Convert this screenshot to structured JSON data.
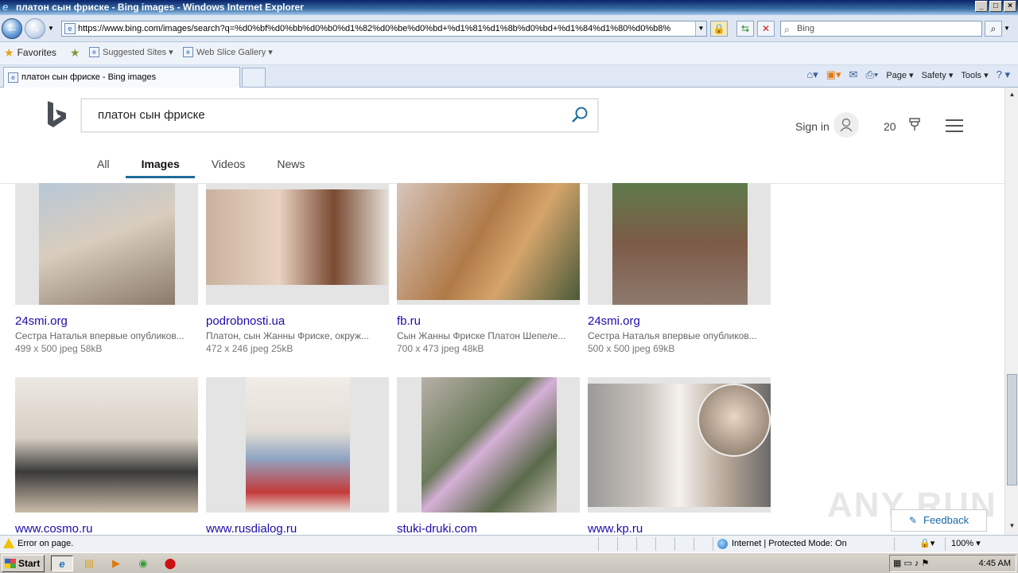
{
  "window": {
    "title": "платон сын фриске - Bing images - Windows Internet Explorer",
    "controls": [
      "_",
      "□",
      "×"
    ]
  },
  "nav": {
    "url": "https://www.bing.com/images/search?q=%d0%bf%d0%bb%d0%b0%d1%82%d0%be%d0%bd+%d1%81%d1%8b%d0%bd+%d1%84%d1%80%d0%b8%",
    "search_placeholder": "Bing"
  },
  "favorites": {
    "label": "Favorites",
    "items": [
      "Suggested Sites ▾",
      "Web Slice Gallery ▾"
    ]
  },
  "tab": {
    "title": "платон сын фриске - Bing images"
  },
  "commands": {
    "page": "Page ▾",
    "safety": "Safety ▾",
    "tools": "Tools ▾",
    "help": "? ▾"
  },
  "bing": {
    "query": "платон сын фриске",
    "sign_in": "Sign in",
    "points": "20",
    "scopes": [
      "All",
      "Images",
      "Videos",
      "News"
    ],
    "active_scope": "Images",
    "feedback": "Feedback"
  },
  "results": [
    {
      "source": "24smi.org",
      "desc": "Сестра Наталья впервые опубликов...",
      "meta": "499 x 500 jpeg 58kB",
      "thumb_color": "#c9b9a6"
    },
    {
      "source": "podrobnosti.ua",
      "desc": "Платон, сын Жанны Фриске, окруж...",
      "meta": "472 x 246 jpeg 25kB",
      "thumb_color": "#d8b4a0"
    },
    {
      "source": "fb.ru",
      "desc": "Сын Жанны Фриске Платон Шепеле...",
      "meta": "700 x 473 jpeg 48kB",
      "thumb_color": "#b58a5c"
    },
    {
      "source": "24smi.org",
      "desc": "Сестра Наталья впервые опубликов...",
      "meta": "500 x 500 jpeg 69kB",
      "thumb_color": "#6d7a5a"
    },
    {
      "source": "www.cosmo.ru",
      "desc": "",
      "meta": "",
      "thumb_color": "#ded8d0"
    },
    {
      "source": "www.rusdialog.ru",
      "desc": "",
      "meta": "",
      "thumb_color": "#e7e2dc"
    },
    {
      "source": "stuki-druki.com",
      "desc": "",
      "meta": "",
      "thumb_color": "#8a8f86"
    },
    {
      "source": "www.kp.ru",
      "desc": "",
      "meta": "",
      "thumb_color": "#d9c7b8"
    }
  ],
  "watermark": "ANY RUN",
  "status": {
    "error": "Error on page.",
    "zone": "Internet | Protected Mode: On",
    "zoom": "100%"
  },
  "taskbar": {
    "start": "Start",
    "clock": "4:45 AM"
  }
}
